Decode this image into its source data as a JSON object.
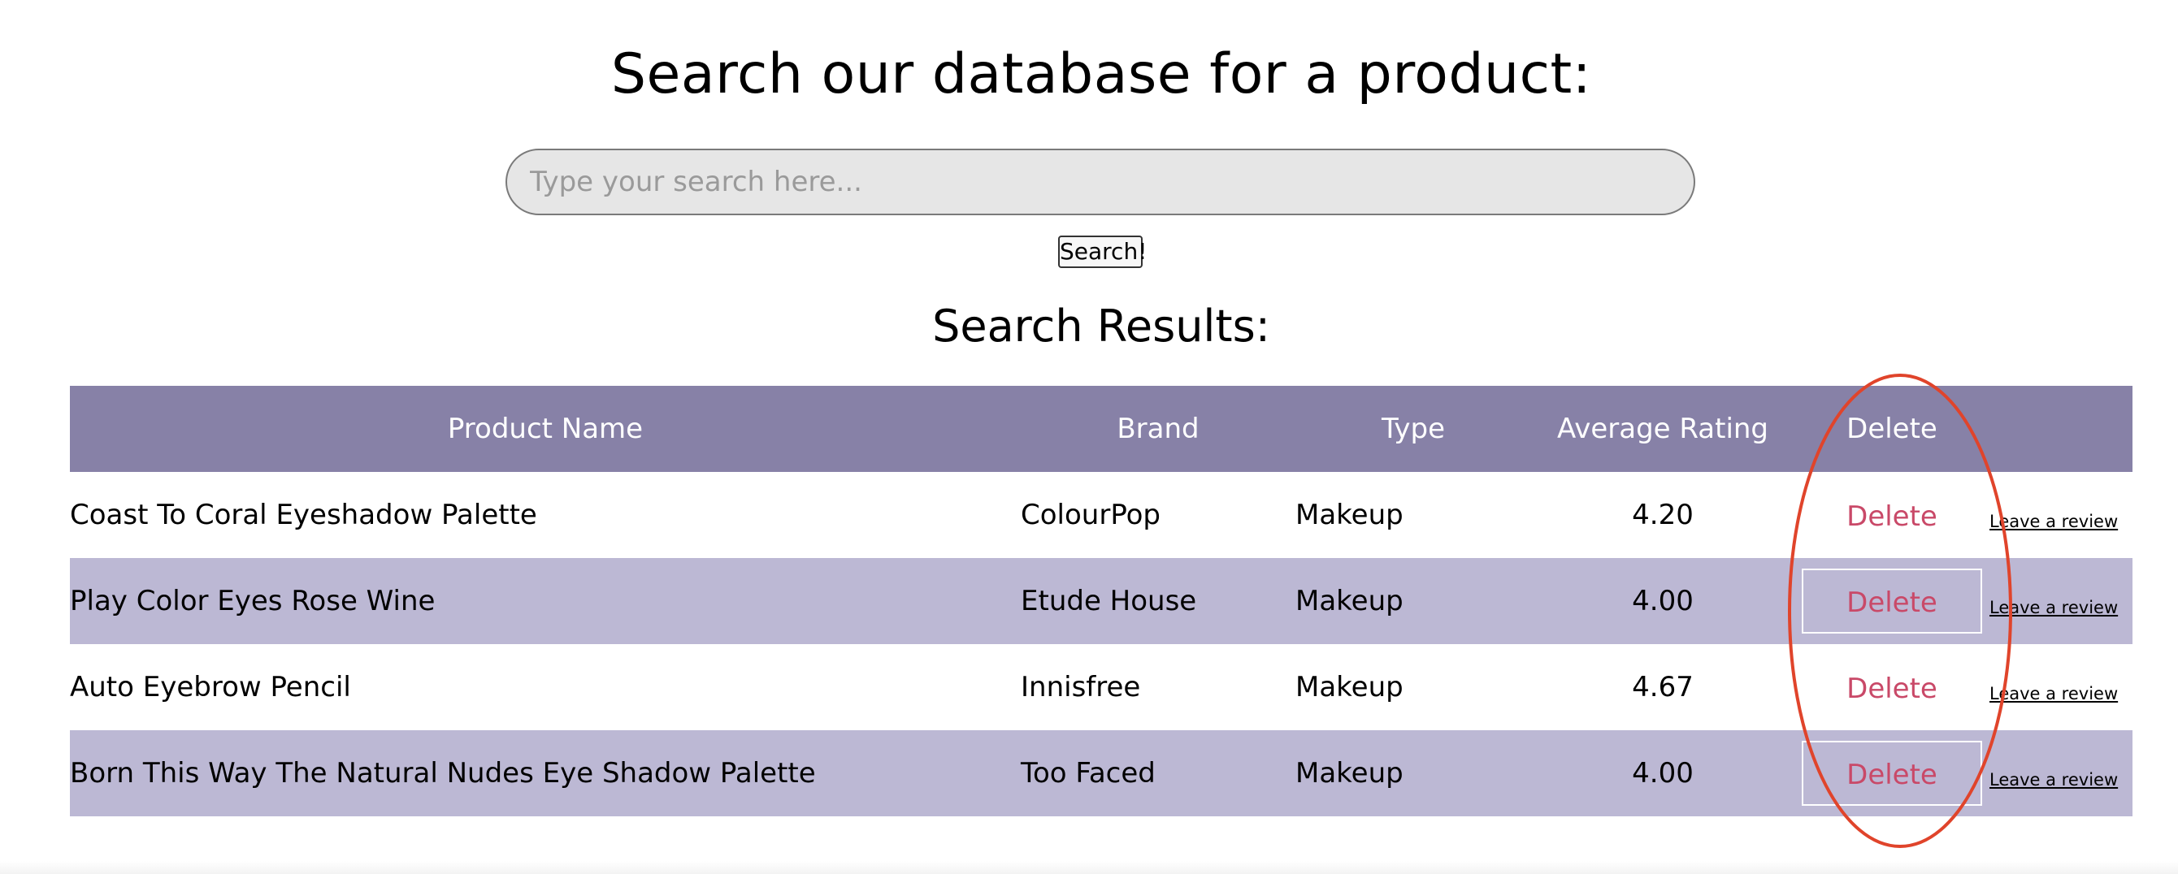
{
  "header": {
    "title": "Search our database for a product:"
  },
  "search": {
    "placeholder": "Type your search here...",
    "value": "",
    "button_label": "Search!"
  },
  "results": {
    "title": "Search Results:",
    "columns": [
      "Product Name",
      "Brand",
      "Type",
      "Average Rating",
      "Delete"
    ],
    "rows": [
      {
        "name": "Coast To Coral Eyeshadow Palette",
        "brand": "ColourPop",
        "type": "Makeup",
        "rating": "4.20",
        "delete_label": "Delete",
        "review_label": "Leave a review"
      },
      {
        "name": "Play Color Eyes Rose Wine",
        "brand": "Etude House",
        "type": "Makeup",
        "rating": "4.00",
        "delete_label": "Delete",
        "review_label": "Leave a review"
      },
      {
        "name": "Auto Eyebrow Pencil",
        "brand": "Innisfree",
        "type": "Makeup",
        "rating": "4.67",
        "delete_label": "Delete",
        "review_label": "Leave a review"
      },
      {
        "name": "Born This Way The Natural Nudes Eye Shadow Palette",
        "brand": "Too Faced",
        "type": "Makeup",
        "rating": "4.00",
        "delete_label": "Delete",
        "review_label": "Leave a review"
      }
    ]
  },
  "colors": {
    "header_bg": "#8781a7",
    "alt_row_bg": "#bcb8d4",
    "delete_text": "#c94968",
    "annotation": "#e0442b"
  }
}
